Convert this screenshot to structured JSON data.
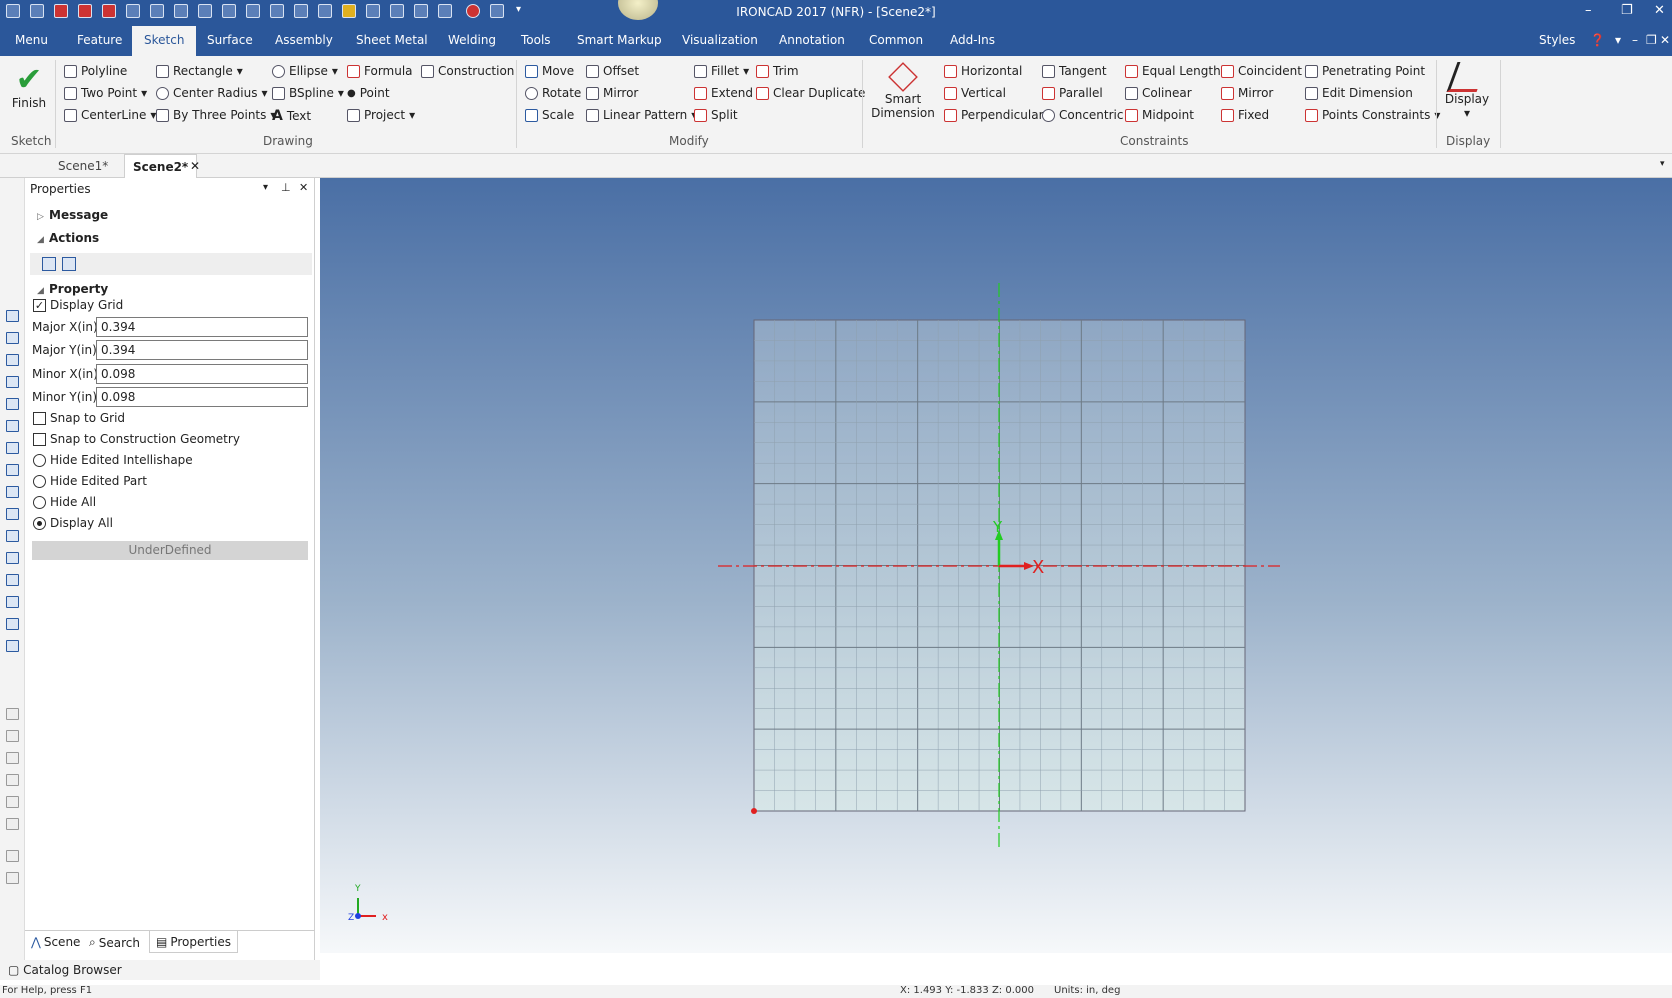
{
  "app": {
    "title": "IRONCAD 2017 (NFR) - [Scene2*]"
  },
  "window_controls": {
    "minimize": "–",
    "restore": "❐",
    "close": "✕"
  },
  "menu_tabs": [
    "Menu",
    "Feature",
    "Sketch",
    "Surface",
    "Assembly",
    "Sheet Metal",
    "Welding",
    "Tools",
    "Smart Markup",
    "Visualization",
    "Annotation",
    "Common",
    "Add-Ins"
  ],
  "menu_right": {
    "styles": "Styles"
  },
  "ribbon": {
    "finish": "Finish",
    "drawing": {
      "col1": [
        "Polyline",
        "Two Point",
        "CenterLine"
      ],
      "col2": [
        "Rectangle",
        "Center Radius",
        "By Three Points"
      ],
      "col3": [
        "Ellipse",
        "BSpline",
        "Text"
      ],
      "col4": [
        "Formula",
        "Point",
        "Project"
      ],
      "construction": "Construction"
    },
    "modify": {
      "col1": [
        "Move",
        "Rotate",
        "Scale"
      ],
      "col2": [
        "Offset",
        "Mirror",
        "Linear Pattern"
      ],
      "col3": [
        "Fillet",
        "Extend",
        "Split"
      ],
      "col4": [
        "Trim",
        "Clear Duplicate"
      ]
    },
    "smart_dimension": [
      "Smart",
      "Dimension"
    ],
    "constraints": {
      "col1": [
        "Horizontal",
        "Vertical",
        "Perpendicular"
      ],
      "col2": [
        "Tangent",
        "Parallel",
        "Concentric"
      ],
      "col3": [
        "Equal Length",
        "Colinear",
        "Midpoint"
      ],
      "col4": [
        "Coincident",
        "Mirror",
        "Fixed"
      ],
      "col5": [
        "Penetrating Point",
        "Edit Dimension",
        "Points Constraints"
      ]
    },
    "display": "Display",
    "groups": {
      "sketch": "Sketch",
      "drawing": "Drawing",
      "modify": "Modify",
      "constraints": "Constraints",
      "display": "Display"
    }
  },
  "doc_tabs": [
    "Scene1*",
    "Scene2*"
  ],
  "panel": {
    "title": "Properties",
    "sections": {
      "message": "Message",
      "actions": "Actions",
      "property": "Property"
    },
    "display_grid": "Display Grid",
    "fields": [
      {
        "label": "Major X(in)",
        "value": "0.394"
      },
      {
        "label": "Major Y(in)",
        "value": "0.394"
      },
      {
        "label": "Minor X(in)",
        "value": "0.098"
      },
      {
        "label": "Minor Y(in)",
        "value": "0.098"
      }
    ],
    "checks": [
      "Snap to Grid",
      "Snap to Construction Geometry"
    ],
    "radios": [
      "Hide Edited Intellishape",
      "Hide Edited Part",
      "Hide All",
      "Display All"
    ],
    "selected_radio": "Display All",
    "status_button": "UnderDefined",
    "bottom_tabs": [
      "Scene",
      "Search",
      "Properties"
    ]
  },
  "viewport": {
    "axis_x": "X",
    "axis_y": "Y",
    "triad_x": "x",
    "triad_y": "Y",
    "triad_z": "Z"
  },
  "catalog": "Catalog Browser",
  "statusbar": {
    "help": "For Help, press F1",
    "coords": "X: 1.493  Y: -1.833  Z: 0.000",
    "units": "Units: in, deg"
  }
}
